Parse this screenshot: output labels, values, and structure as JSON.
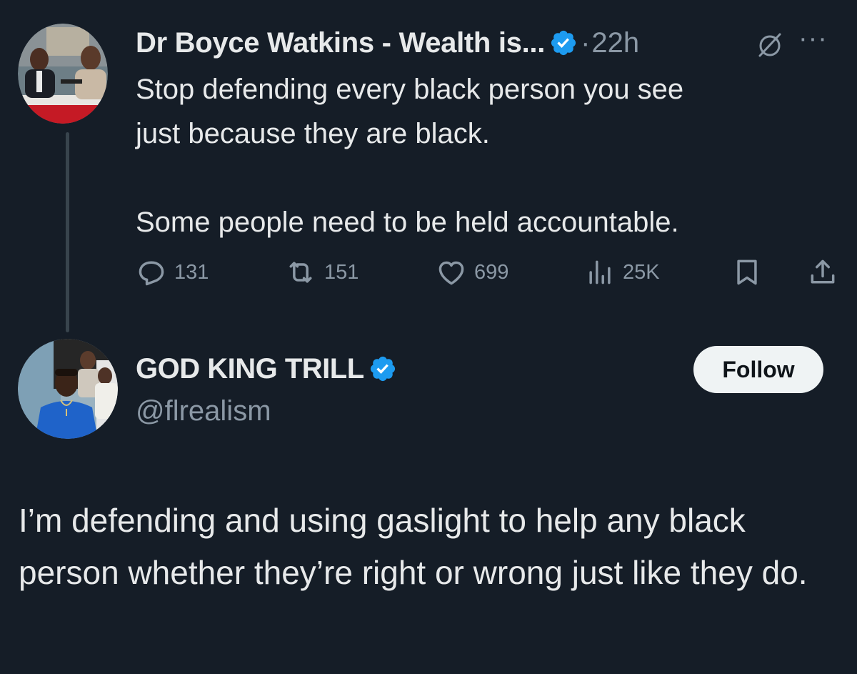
{
  "parent_tweet": {
    "author_name": "Dr Boyce Watkins - Wealth is...",
    "separator": "·",
    "time": "22h",
    "more_label": "···",
    "text_lines": [
      "Stop defending every black person you see",
      "just because they are black."
    ],
    "text_paragraph_2": "Some people need to be held accountable.",
    "stats": {
      "replies": "131",
      "reposts": "151",
      "likes": "699",
      "views": "25K"
    },
    "icons": {
      "verified": "verified-badge-icon",
      "grok": "grok-icon",
      "more": "more-icon",
      "reply": "reply-icon",
      "repost": "repost-icon",
      "like": "heart-icon",
      "views": "views-icon",
      "bookmark": "bookmark-icon",
      "share": "share-icon"
    }
  },
  "reply_tweet": {
    "author_name": "GOD KING TRILL",
    "handle": "@flrealism",
    "follow_label": "Follow",
    "text": "I’m defending and using gaslight to help any black person whether they’re right or wrong just like they do."
  },
  "colors": {
    "background": "#151d27",
    "text_primary": "#e7e9ea",
    "text_secondary": "#8b98a5",
    "verified_blue": "#1d9bf0",
    "follow_bg": "#eff3f4"
  }
}
